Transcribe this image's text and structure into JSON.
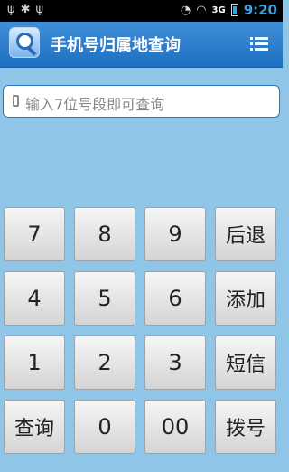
{
  "status_bar": {
    "left_icons": [
      "usb-icon",
      "android-debug-icon",
      "usb-icon"
    ],
    "right_icons": [
      "alarm-icon",
      "wifi-icon",
      "network-icon",
      "battery-icon"
    ],
    "network_type": "3G",
    "time": "9:20"
  },
  "app_bar": {
    "title": "手机号归属地查询",
    "menu_icon": "list-menu-icon"
  },
  "search": {
    "placeholder": "输入7位号段即可查询",
    "value": ""
  },
  "keypad": {
    "keys": [
      {
        "label": "7"
      },
      {
        "label": "8"
      },
      {
        "label": "9"
      },
      {
        "label": "后退"
      },
      {
        "label": "4"
      },
      {
        "label": "5"
      },
      {
        "label": "6"
      },
      {
        "label": "添加"
      },
      {
        "label": "1"
      },
      {
        "label": "2"
      },
      {
        "label": "3"
      },
      {
        "label": "短信"
      },
      {
        "label": "查询"
      },
      {
        "label": "0"
      },
      {
        "label": "00"
      },
      {
        "label": "拨号"
      }
    ]
  },
  "colors": {
    "background": "#8fc6e8",
    "app_bar": "#2a7ccd",
    "accent_time": "#36a2e6"
  }
}
